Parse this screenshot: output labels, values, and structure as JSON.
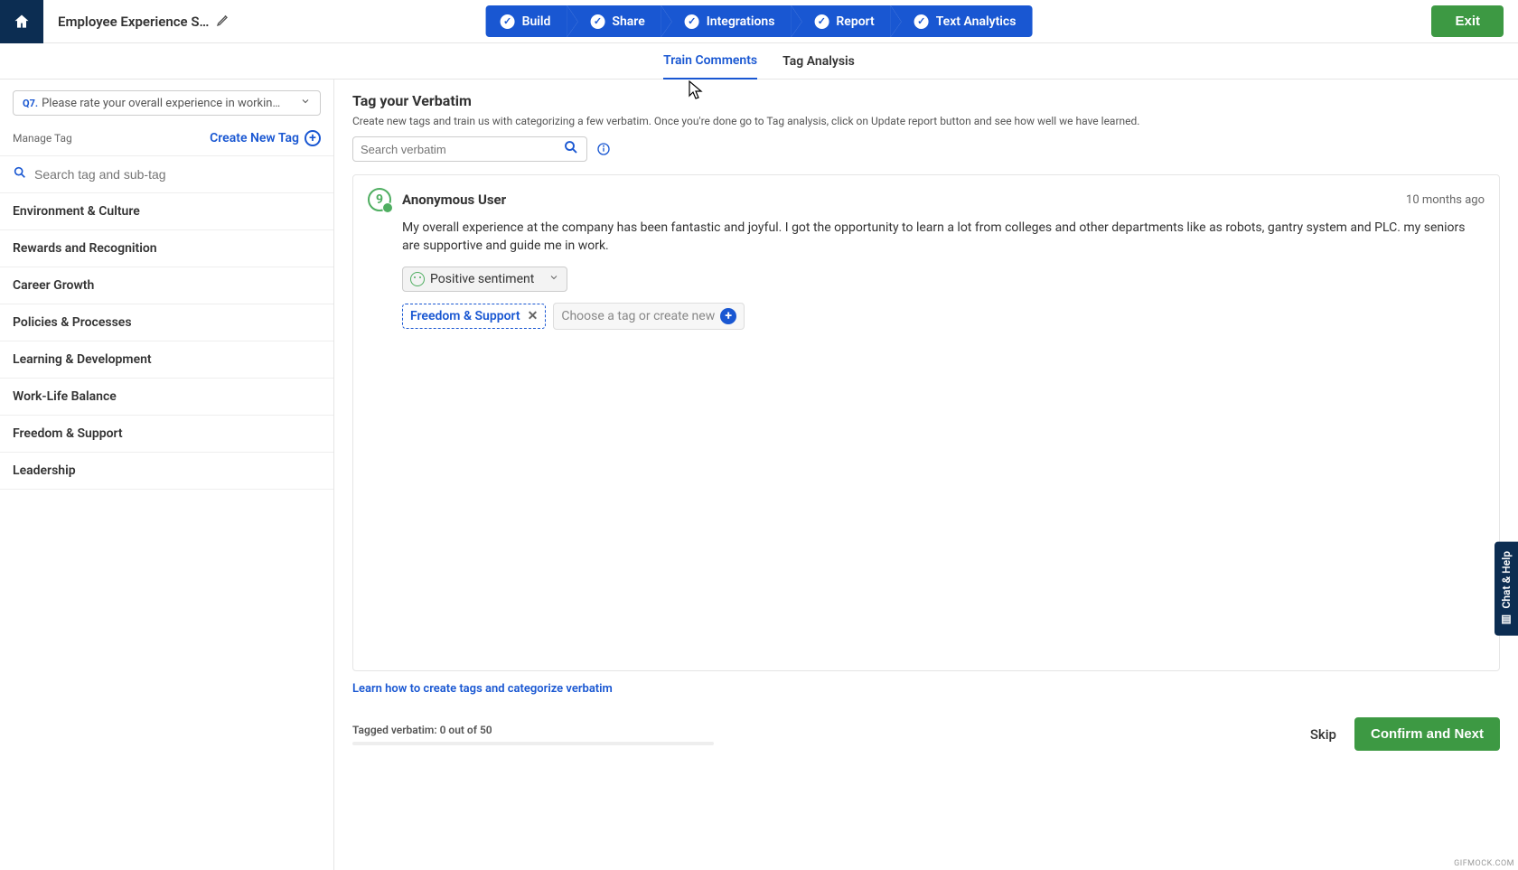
{
  "header": {
    "title": "Employee Experience S…",
    "exit": "Exit",
    "steps": [
      "Build",
      "Share",
      "Integrations",
      "Report",
      "Text Analytics"
    ]
  },
  "subnav": {
    "train": "Train Comments",
    "analysis": "Tag Analysis"
  },
  "sidebar": {
    "question_prefix": "Q7.",
    "question_text": "Please rate your overall experience in workin…",
    "manage_label": "Manage Tag",
    "create_tag": "Create New Tag",
    "search_placeholder": "Search tag and sub-tag",
    "tags": [
      "Environment & Culture",
      "Rewards and Recognition",
      "Career Growth",
      "Policies & Processes",
      "Learning & Development",
      "Work-Life Balance",
      "Freedom & Support",
      "Leadership"
    ]
  },
  "main": {
    "heading": "Tag your Verbatim",
    "subheading": "Create new tags and train us with categorizing a few verbatim. Once you're done go to Tag analysis, click on Update report button and see how well we have learned.",
    "search_placeholder": "Search verbatim",
    "verbatim": {
      "avatar_score": "9",
      "user": "Anonymous User",
      "timestamp": "10 months ago",
      "text": "My overall experience at the company has been fantastic and joyful. I got the opportunity to learn a lot from colleges and other departments like as robots, gantry system and PLC. my seniors are supportive and guide me in work.",
      "sentiment": "Positive sentiment",
      "applied_tag": "Freedom & Support",
      "choose_tag": "Choose a tag or create new"
    },
    "learn_link": "Learn how to create tags and categorize verbatim",
    "footer": {
      "progress": "Tagged verbatim: 0 out of 50",
      "skip": "Skip",
      "confirm": "Confirm and Next"
    }
  },
  "chat_help": "Chat & Help",
  "watermark": "GIFMOCK.COM"
}
